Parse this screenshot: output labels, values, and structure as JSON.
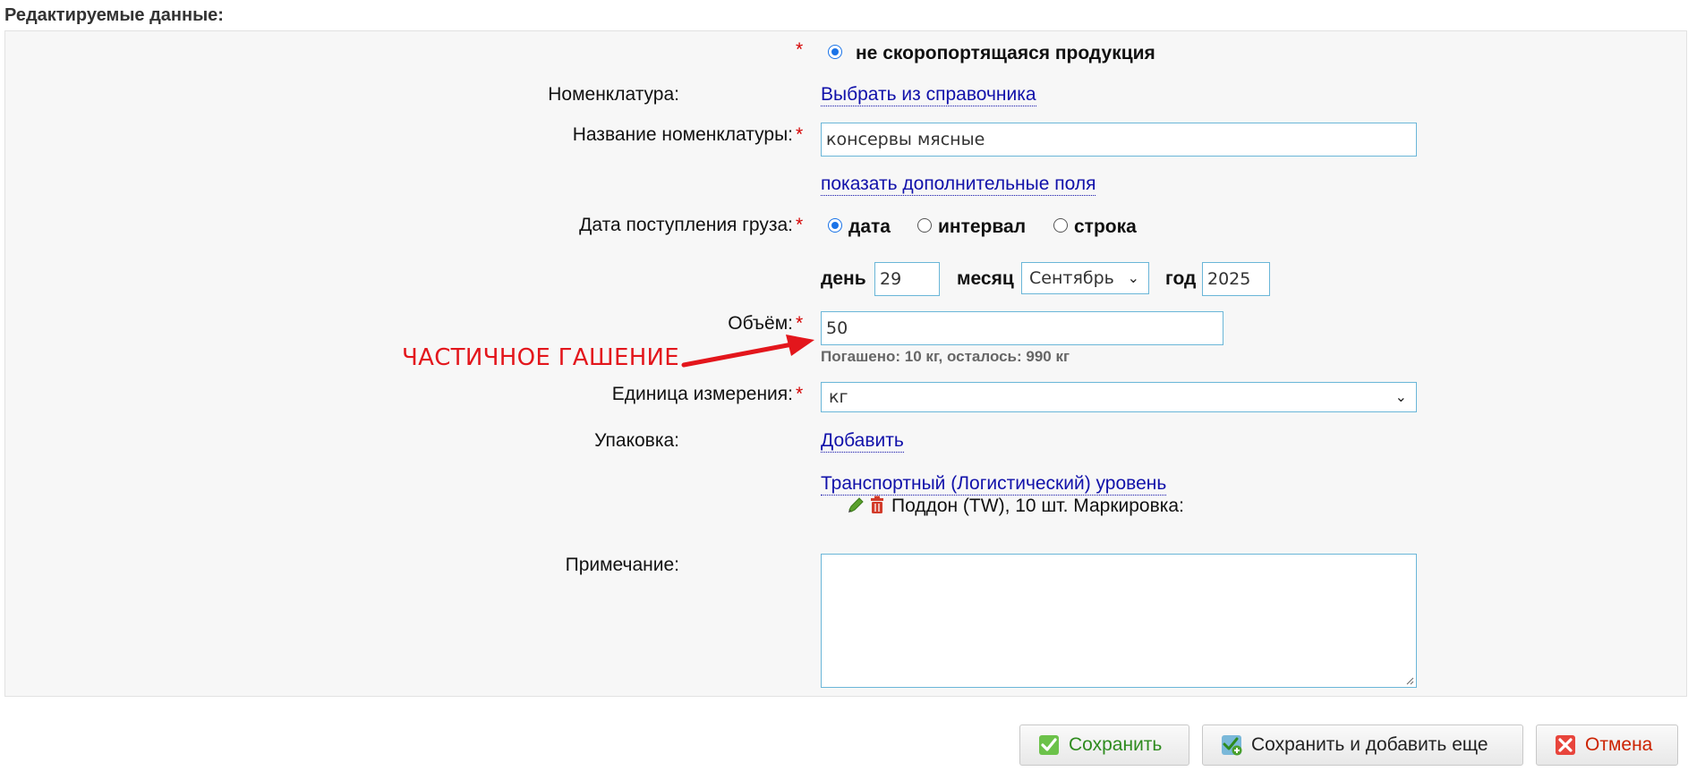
{
  "section_title": "Редактируемые данные:",
  "product_type": {
    "label": "не скоропортящаяся продукция"
  },
  "nomenclature": {
    "label": "Номенклатура:",
    "link": "Выбрать из справочника"
  },
  "nomenclature_name": {
    "label": "Название номенклатуры:",
    "value": "консервы мясные"
  },
  "extra_fields_link": "показать дополнительные поля",
  "arrival_date": {
    "label": "Дата поступления груза:",
    "options": [
      "дата",
      "интервал",
      "строка"
    ],
    "selected": "дата",
    "day_label": "день",
    "day_value": "29",
    "month_label": "месяц",
    "month_value": "Сентябрь",
    "year_label": "год",
    "year_value": "2025"
  },
  "volume": {
    "label": "Объём:",
    "value": "50",
    "hint": "Погашено: 10 кг, осталось: 990 кг"
  },
  "annotation": {
    "text": "ЧАСТИЧНОЕ ГАШЕНИЕ",
    "color": "#e3161c"
  },
  "unit": {
    "label": "Единица измерения:",
    "value": "кг"
  },
  "packaging": {
    "label": "Упаковка:",
    "add_link": "Добавить",
    "level_link": "Транспортный (Логистический) уровень",
    "item_text": "Поддон (TW), 10 шт. Маркировка:"
  },
  "note": {
    "label": "Примечание:",
    "value": ""
  },
  "required_mark": "*",
  "buttons": {
    "save": "Сохранить",
    "save_add": "Сохранить и добавить еще",
    "cancel": "Отмена"
  },
  "icons": {
    "edit": "pencil-icon",
    "delete": "trash-icon",
    "save": "check-icon",
    "save_add": "check-add-icon",
    "cancel": "x-icon"
  },
  "colors": {
    "required": "#d40000",
    "link": "#1111aa",
    "input_border": "#6ab6d8",
    "save_text": "#2e8b1e",
    "cancel_text": "#cc2200"
  }
}
